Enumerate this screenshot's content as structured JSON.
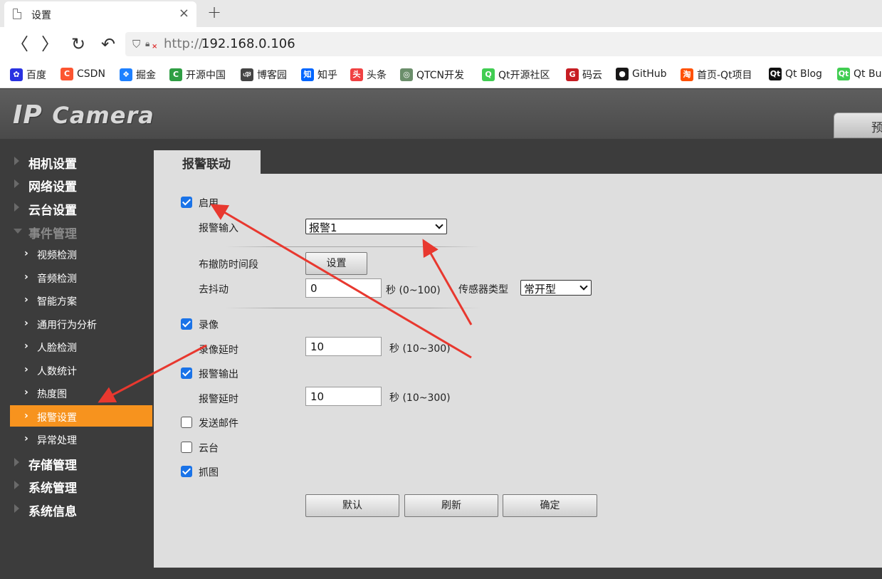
{
  "browser": {
    "tab_title": "设置",
    "tab_close": "×",
    "new_tab": "+",
    "url_protocol": "http://",
    "url_host": "192.168.0.106",
    "nav": {
      "back": "〈",
      "forward": "〉",
      "reload": "↻",
      "undo": "↶"
    }
  },
  "bookmarks": [
    {
      "label": "百度",
      "icon": "baidu-icon",
      "color": "#2932e1",
      "glyph": "✿"
    },
    {
      "label": "CSDN",
      "icon": "csdn-icon",
      "color": "#fc5531",
      "glyph": "C"
    },
    {
      "label": "掘金",
      "icon": "juejin-icon",
      "color": "#1e80ff",
      "glyph": "❖"
    },
    {
      "label": "开源中国",
      "icon": "oschina-icon",
      "color": "#2f9e44",
      "glyph": "C"
    },
    {
      "label": "博客园",
      "icon": "cnblogs-icon",
      "color": "#444444",
      "glyph": "ঞ"
    },
    {
      "label": "知乎",
      "icon": "zhihu-icon",
      "color": "#0066ff",
      "glyph": "知"
    },
    {
      "label": "头条",
      "icon": "toutiao-icon",
      "color": "#f04142",
      "glyph": "头"
    },
    {
      "label": "QTCN开发",
      "icon": "qtcn-icon",
      "color": "#6b8e6b",
      "glyph": "◎"
    },
    {
      "label": "Qt开源社区",
      "icon": "qt-community-icon",
      "color": "#41cd52",
      "glyph": "Q"
    },
    {
      "label": "码云",
      "icon": "gitee-icon",
      "color": "#c71d23",
      "glyph": "G"
    },
    {
      "label": "GitHub",
      "icon": "github-icon",
      "color": "#181717",
      "glyph": "●"
    },
    {
      "label": "首页-Qt项目",
      "icon": "taobao-icon",
      "color": "#ff5000",
      "glyph": "淘"
    },
    {
      "label": "Qt Blog",
      "icon": "qt-blog-icon",
      "color": "#111111",
      "glyph": "Qt"
    },
    {
      "label": "Qt Bu",
      "icon": "qt-bugs-icon",
      "color": "#41cd52",
      "glyph": "Qt"
    }
  ],
  "camera": {
    "logo_ip": "IP",
    "logo_camera": "Camera",
    "preview_label": "预"
  },
  "sidebar": {
    "main_items": [
      {
        "label": "相机设置"
      },
      {
        "label": "网络设置"
      },
      {
        "label": "云台设置"
      },
      {
        "label": "事件管理"
      }
    ],
    "sub_items": [
      {
        "label": "视频检测"
      },
      {
        "label": "音频检测"
      },
      {
        "label": "智能方案"
      },
      {
        "label": "通用行为分析"
      },
      {
        "label": "人脸检测"
      },
      {
        "label": "人数统计"
      },
      {
        "label": "热度图"
      },
      {
        "label": "报警设置"
      },
      {
        "label": "异常处理"
      }
    ],
    "bottom_items": [
      {
        "label": "存储管理"
      },
      {
        "label": "系统管理"
      },
      {
        "label": "系统信息"
      }
    ]
  },
  "panel": {
    "tab_label": "报警联动",
    "enable": {
      "label": "启用",
      "checked": true
    },
    "alarm_input": {
      "label": "报警输入",
      "value": "报警1"
    },
    "schedule": {
      "label": "布撤防时间段",
      "button": "设置"
    },
    "debounce": {
      "label": "去抖动",
      "value": "0",
      "unit": "秒 (0~100)"
    },
    "sensor_type": {
      "label": "传感器类型",
      "value": "常开型"
    },
    "record": {
      "label": "录像",
      "checked": true
    },
    "record_delay": {
      "label": "录像延时",
      "value": "10",
      "unit": "秒 (10~300)"
    },
    "alarm_output": {
      "label": "报警输出",
      "checked": true
    },
    "alarm_delay": {
      "label": "报警延时",
      "value": "10",
      "unit": "秒 (10~300)"
    },
    "send_email": {
      "label": "发送邮件",
      "checked": false
    },
    "ptz": {
      "label": "云台",
      "checked": false
    },
    "snapshot": {
      "label": "抓图",
      "checked": true
    },
    "buttons": {
      "default": "默认",
      "refresh": "刷新",
      "ok": "确定"
    }
  },
  "annotation_color": "#e8382f"
}
